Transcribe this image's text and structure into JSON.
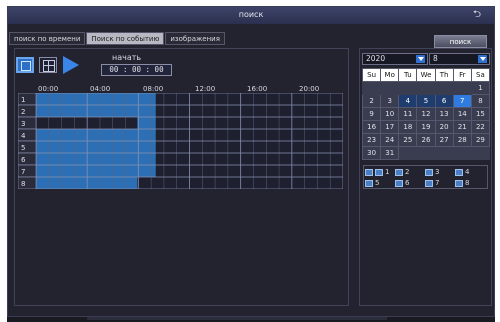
{
  "window": {
    "title": "поиск"
  },
  "tabs": [
    {
      "label": "поиск по времени"
    },
    {
      "label": "Поиск по событию"
    },
    {
      "label": "изображения"
    }
  ],
  "search_button": "поиск",
  "start": {
    "label": "начать",
    "time": "00 : 00 : 00"
  },
  "timeline": {
    "hours": [
      "00:00",
      "04:00",
      "08:00",
      "12:00",
      "16:00",
      "20:00"
    ],
    "channels": [
      "1",
      "2",
      "3",
      "4",
      "5",
      "6",
      "7",
      "8"
    ],
    "recordings_fraction": [
      {
        "channel": "1",
        "from": 0.0,
        "to": 0.39
      },
      {
        "channel": "2",
        "from": 0.0,
        "to": 0.39
      },
      {
        "channel": "3",
        "from": 0.33,
        "to": 0.39
      },
      {
        "channel": "4",
        "from": 0.0,
        "to": 0.39
      },
      {
        "channel": "5",
        "from": 0.0,
        "to": 0.39
      },
      {
        "channel": "6",
        "from": 0.0,
        "to": 0.39
      },
      {
        "channel": "7",
        "from": 0.0,
        "to": 0.39
      },
      {
        "channel": "8",
        "from": 0.0,
        "to": 0.33
      }
    ]
  },
  "calendar": {
    "year": "2020",
    "month": "8",
    "weekdays": [
      "Su",
      "Mo",
      "Tu",
      "We",
      "Th",
      "Fr",
      "Sa"
    ],
    "weeks": [
      [
        "",
        "",
        "",
        "",
        "",
        "",
        "1"
      ],
      [
        "2",
        "3",
        "4",
        "5",
        "6",
        "7",
        "8"
      ],
      [
        "9",
        "10",
        "11",
        "12",
        "13",
        "14",
        "15"
      ],
      [
        "16",
        "17",
        "18",
        "19",
        "20",
        "21",
        "22"
      ],
      [
        "23",
        "24",
        "25",
        "26",
        "27",
        "28",
        "29"
      ],
      [
        "30",
        "31",
        "",
        "",
        "",
        "",
        ""
      ]
    ],
    "marked_days": [
      "4",
      "5",
      "6"
    ],
    "selected_day": "7"
  },
  "channel_checks": [
    "1",
    "2",
    "3",
    "4",
    "5",
    "6",
    "7",
    "8"
  ],
  "colors": {
    "accent": "#2f7be0",
    "record": "#2c6fb5",
    "background": "#232330"
  }
}
